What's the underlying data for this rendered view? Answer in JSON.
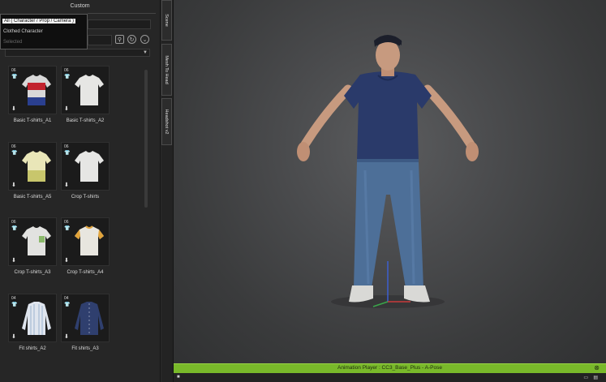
{
  "panel": {
    "title": "Custom",
    "dropdown": {
      "items": [
        "All ( Character / Prop / Camera )",
        "Clothed Character",
        "Selected"
      ],
      "selected_index": 0
    }
  },
  "side_tabs": [
    "Scene",
    "Mesh To Head",
    "Headshot v2"
  ],
  "items": [
    {
      "label": "Basic T-shirts_A1",
      "badge": "06",
      "style": "flag"
    },
    {
      "label": "Basic T-shirts_A2",
      "badge": "06",
      "style": "white"
    },
    {
      "label": "Basic T-shirts_A5",
      "badge": "06",
      "style": "yellow"
    },
    {
      "label": "Crop T-shirts",
      "badge": "06",
      "style": "white"
    },
    {
      "label": "Crop T-shirts_A3",
      "badge": "06",
      "style": "green-pocket"
    },
    {
      "label": "Crop T-shirts_A4",
      "badge": "06",
      "style": "orange"
    },
    {
      "label": "Fit shirts_A2",
      "badge": "04",
      "style": "stripe-shirt"
    },
    {
      "label": "Fit shirts_A3",
      "badge": "04",
      "style": "navy-shirt"
    }
  ],
  "icons": {
    "item_type": "tshirt-icon",
    "download": "download-arrow-icon"
  },
  "animation_player": {
    "title": "Animation Player : CC3_Base_Plus - A-Pose"
  },
  "colors": {
    "accent_green": "#79b92a",
    "panel_bg": "#262626"
  }
}
